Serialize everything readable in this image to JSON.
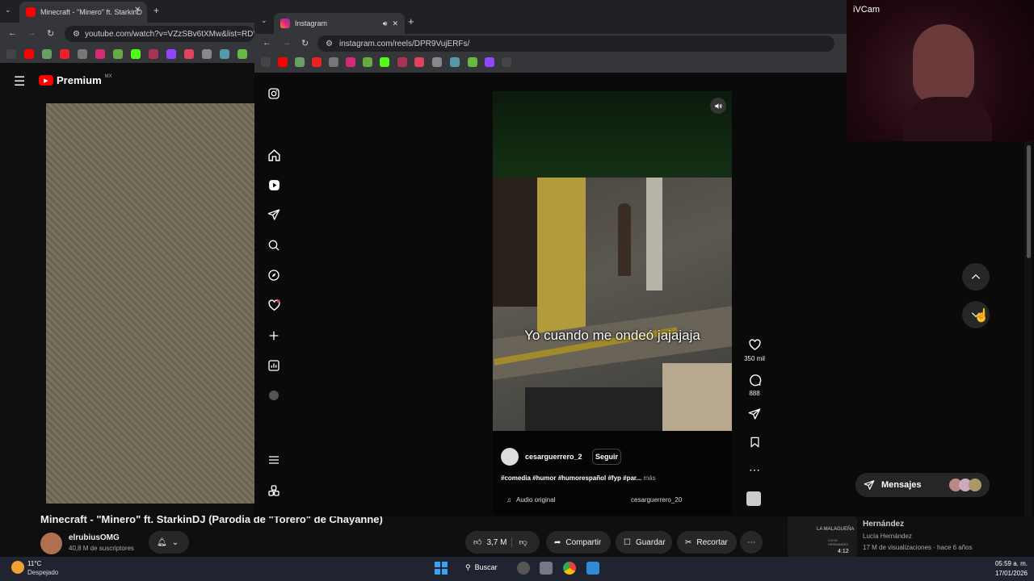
{
  "yt_browser": {
    "tab_title": "Minecraft - \"Minero\" ft. StarkinD",
    "url": "youtube.com/watch?v=VZzSBv6tXMw&list=RDVZzS",
    "premium_label": "Premium",
    "premium_region": "MX",
    "video_title": "Minecraft - \"Minero\" ft. StarkinDJ (Parodia de \"Torero\" de Chayanne)",
    "channel_name": "elrubiusOMG",
    "subscribers": "40,8 M de suscriptores",
    "likes": "3,7 M",
    "share_label": "Compartir",
    "save_label": "Guardar",
    "clip_label": "Recortar",
    "suggestion": {
      "title_partial": "Hernández",
      "thumb_text": "LA MALAGUEÑA",
      "thumb_subtext": "LUCIA HERNANDEZ",
      "duration": "4:12",
      "artist": "Lucía Hernández",
      "meta": "17 M de visualizaciones · hace 6 años"
    }
  },
  "ig_browser": {
    "tab_title": "Instagram",
    "url": "instagram.com/reels/DPR9VujERFs/"
  },
  "reel": {
    "overlay_text": "Yo cuando me ondeó jajajaja",
    "likes": "350 mil",
    "comments": "888",
    "username": "cesarguerrero_2",
    "follow_label": "Seguir",
    "caption": "#comedia #humor #humorespañol #fyp #par...",
    "more_label": "más",
    "audio_label": "Audio original",
    "audio_user": "cesarguerrero_20"
  },
  "messages": {
    "label": "Mensajes"
  },
  "webcam": {
    "label": "iVCam"
  },
  "taskbar": {
    "weather_temp": "11°C",
    "weather_desc": "Despejado",
    "search_label": "Buscar",
    "time": "05:59 a. m.",
    "date": "17/01/2026"
  },
  "colors": {
    "instagram_bg": "#000000",
    "youtube_red": "#ff0000",
    "follow_bg": "#363636",
    "taskbar_bg": "#1f2430"
  },
  "icons": [
    "instagram-icon",
    "home-icon",
    "reels-icon",
    "send-icon",
    "search-icon",
    "explore-icon",
    "heart-icon",
    "create-icon",
    "dashboard-icon",
    "menu-icon",
    "threads-icon",
    "speaker-icon",
    "comment-icon",
    "bookmark-icon",
    "more-icon",
    "chevron-up-icon",
    "chevron-down-icon"
  ]
}
